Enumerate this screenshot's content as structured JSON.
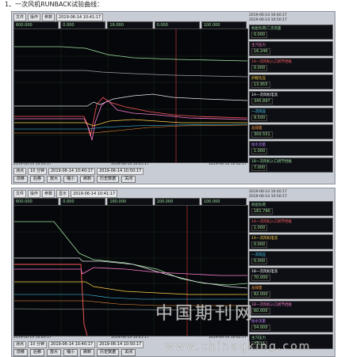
{
  "heading": "1、一次风机RUNBACK试验曲线：",
  "screens": [
    {
      "toolbar": [
        "文件",
        "操作",
        "参数",
        "2019-06-14 10:41:17"
      ],
      "values": [
        "600.000",
        "0.000",
        "16.000",
        "0.000",
        "100.000"
      ],
      "time_axis": [
        "2019-06-14 10:40:17",
        "2019-06-14 10:41:17",
        "2019-06-14 10:42:17"
      ],
      "bottom": [
        "测点",
        "10 分钟",
        "2019-06-14 10:40:17",
        "2019-06-14 10:50:17"
      ],
      "buttons": [
        "前移",
        "后移",
        "放大",
        "缩小",
        "刷新",
        "历史数据",
        "关闭"
      ],
      "side_time": [
        "2019-06-14 10:40:17",
        "2019-06-14 10:50:17"
      ],
      "legend": [
        {
          "name": "机组负荷/二次风量",
          "value": "0.000",
          "color": "#9fe09f"
        },
        {
          "name": "主汽压力",
          "value": "16.246",
          "color": "#ff7fd0"
        },
        {
          "name": "1A一次风机入口调节挡板",
          "value": "0.000",
          "color": "#ff6060"
        },
        {
          "name": "炉膛负压",
          "value": "13.955",
          "color": "#ffd24a"
        },
        {
          "name": "1A一次风机电流",
          "value": "345.897",
          "color": "#ffffff"
        },
        {
          "name": "一次风压",
          "value": "9.500",
          "color": "#4ad6ff"
        },
        {
          "name": "总煤量",
          "value": "300.551",
          "color": "#ff9a3a"
        },
        {
          "name": "给水流量",
          "value": "1.000",
          "color": "#c080ff"
        },
        {
          "name": "1B一次风机入口调节挡板",
          "value": "7.000",
          "color": "#9fe09f"
        }
      ]
    },
    {
      "toolbar": [
        "文件",
        "操作",
        "参数",
        "显示",
        "2019-06-14 10:41:17"
      ],
      "values": [
        "600.000",
        "0.000",
        "160.000",
        "100.000",
        "100.000"
      ],
      "time_axis": [
        "2019-06-14 10:40:17",
        "2019-06-14 10:41:17",
        "2019-06-14 10:42:17"
      ],
      "bottom": [
        "测点",
        "10 分钟",
        "2019-06-14 10:40:17",
        "2019-06-14 10:50:17"
      ],
      "buttons": [
        "前移",
        "后移",
        "放大",
        "缩小",
        "刷新",
        "历史数据",
        "关闭"
      ],
      "side_time": [
        "2019-06-14 10:40:17",
        "2019-06-14 10:50:17"
      ],
      "legend": [
        {
          "name": "机组负荷",
          "value": "181.790",
          "color": "#9fe09f"
        },
        {
          "name": "1A一次风机入口调节挡板",
          "value": "1.000",
          "color": "#ff6060"
        },
        {
          "name": "1A一次风机电流",
          "value": "0.000",
          "color": "#ffd24a"
        },
        {
          "name": "一次风压",
          "value": "0.000",
          "color": "#4ad6ff"
        },
        {
          "name": "1B一次风机电流",
          "value": "70.000",
          "color": "#ffffff"
        },
        {
          "name": "总煤量",
          "value": "82.000",
          "color": "#ff9a3a"
        },
        {
          "name": "1B一次风机入口调节挡板",
          "value": "60.000",
          "color": "#ff7fd0"
        },
        {
          "name": "给水流量",
          "value": "54.000",
          "color": "#c080ff"
        },
        {
          "name": "主汽压力",
          "value": "7.511",
          "color": "#9fe09f"
        }
      ]
    }
  ],
  "watermark": {
    "text": "中国期刊网",
    "url": "www.chinaqking.com"
  }
}
